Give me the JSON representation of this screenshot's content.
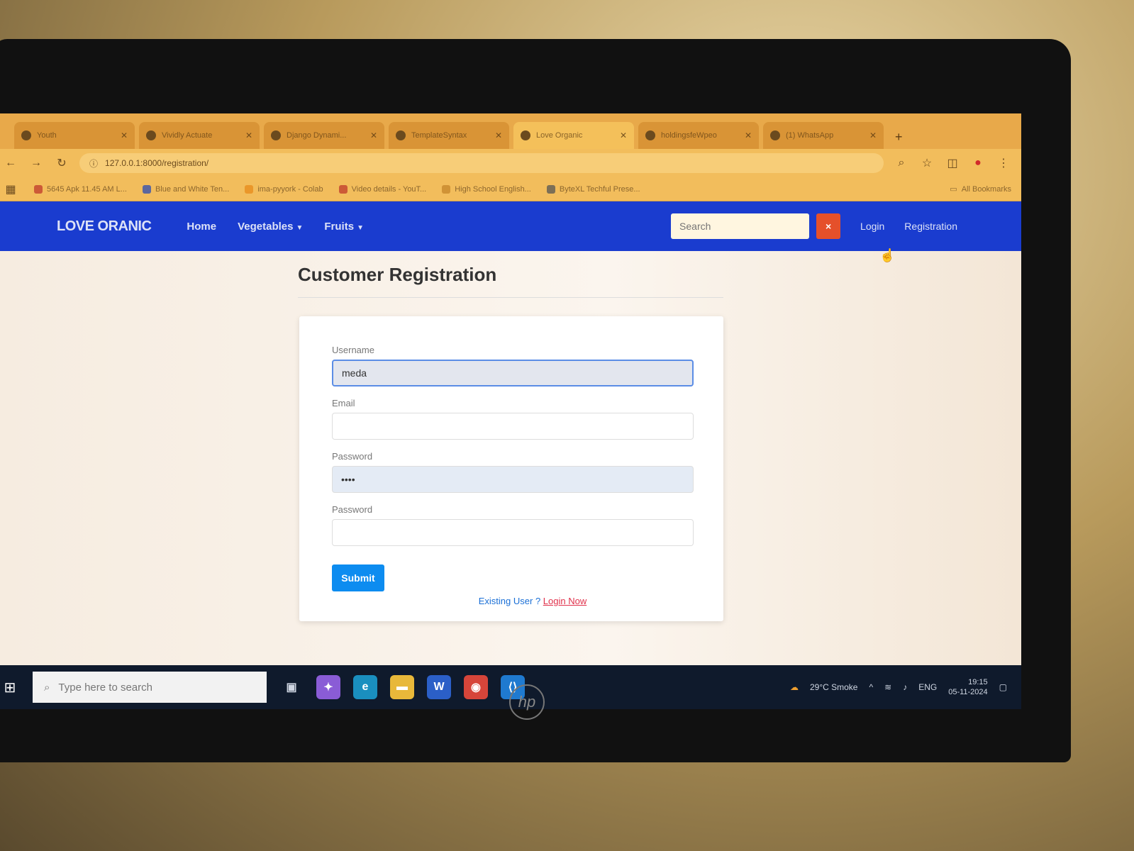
{
  "tabs": [
    {
      "label": "Youth",
      "active": false
    },
    {
      "label": "Vividly Actuate",
      "active": false
    },
    {
      "label": "Django Dynami...",
      "active": false
    },
    {
      "label": "TemplateSyntax",
      "active": false
    },
    {
      "label": "Love Organic",
      "active": true
    },
    {
      "label": "holdingsfeWpeo",
      "active": false
    },
    {
      "label": "(1) WhatsApp",
      "active": false
    }
  ],
  "browser": {
    "url": "127.0.0.1:8000/registration/"
  },
  "bookmarks": [
    {
      "label": "5645 Apk 11.45 AM L..."
    },
    {
      "label": "Blue and White Ten..."
    },
    {
      "label": "ima-pyyork - Colab"
    },
    {
      "label": "Video details - YouT..."
    },
    {
      "label": "High School English..."
    },
    {
      "label": "ByteXL Techful Prese..."
    }
  ],
  "bookmarks_right": "All Bookmarks",
  "site": {
    "brand": "LOVE ORANIC",
    "nav": {
      "home": "Home",
      "vegetables": "Vegetables",
      "fruits": "Fruits"
    },
    "search_placeholder": "Search",
    "search_button": "×",
    "login": "Login",
    "registration": "Registration"
  },
  "form": {
    "title": "Customer Registration",
    "username_label": "Username",
    "username_value": "meda",
    "email_label": "Email",
    "email_value": "",
    "password_label": "Password",
    "password_value": "••••",
    "password2_label": "Password",
    "password2_value": "",
    "submit": "Submit",
    "existing_user": "Existing User ?",
    "login_now": "Login Now"
  },
  "taskbar": {
    "search_placeholder": "Type here to search",
    "weather": "29°C Smoke",
    "lang": "ENG",
    "time": "19:15",
    "date": "05-11-2024"
  },
  "colors": {
    "navbar": "#1a3ccf",
    "search_button": "#e5502a",
    "submit": "#0d8cf0",
    "login_now": "#e0304a"
  },
  "laptop_brand": "hp"
}
